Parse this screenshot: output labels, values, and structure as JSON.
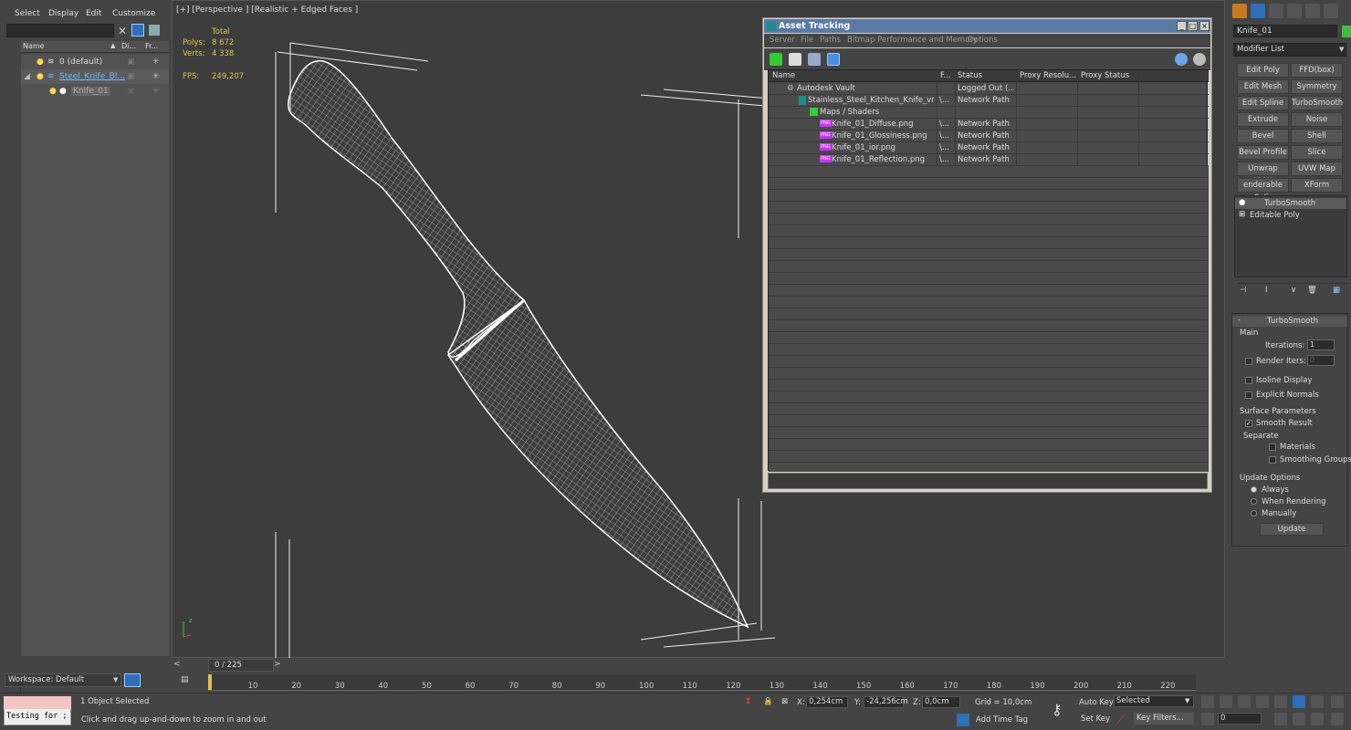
{
  "explorer": {
    "menu": [
      "Select",
      "Display",
      "Edit",
      "Customize"
    ],
    "columns": [
      "Name",
      "Di...",
      "Fr..."
    ],
    "rows": [
      {
        "label": "0 (default)"
      },
      {
        "label": "Steel_Knife_Bl..."
      },
      {
        "label": "Knife_01"
      }
    ],
    "workspace_label": "Workspace: Default"
  },
  "viewport": {
    "label": "[+] [Perspective ] [Realistic + Edged Faces ]",
    "stats_total_label": "Total",
    "polys_label": "Polys:",
    "polys_value": "8 672",
    "verts_label": "Verts:",
    "verts_value": "4 338",
    "fps_label": "FPS:",
    "fps_value": "249,207"
  },
  "asset_tracking": {
    "title": "Asset Tracking",
    "menu": [
      "Server",
      "File",
      "Paths",
      "Bitmap Performance and Memory",
      "Options"
    ],
    "columns": [
      "Name",
      "F...",
      "Status",
      "Proxy Resolu...",
      "Proxy Status"
    ],
    "rows": [
      {
        "name": "Autodesk Vault",
        "f": "",
        "status": "Logged Out (...",
        "indent": 1
      },
      {
        "name": "Stainless_Steel_Kitchen_Knife_vra...",
        "f": "\\...",
        "status": "Network Path",
        "indent": 2
      },
      {
        "name": "Maps / Shaders",
        "f": "",
        "status": "",
        "indent": 3
      },
      {
        "name": "Knife_01_Diffuse.png",
        "f": "\\...",
        "status": "Network Path",
        "indent": 4
      },
      {
        "name": "Knife_01_Glossiness.png",
        "f": "\\...",
        "status": "Network Path",
        "indent": 4
      },
      {
        "name": "Knife_01_ior.png",
        "f": "\\...",
        "status": "Network Path",
        "indent": 4
      },
      {
        "name": "Knife_01_Reflection.png",
        "f": "\\...",
        "status": "Network Path",
        "indent": 4
      }
    ],
    "png_badge": "PNG"
  },
  "command_panel": {
    "object_name": "Knife_01",
    "color": "#3fbf3f",
    "modifier_list": "Modifier List",
    "buttons": [
      "Edit Poly",
      "FFD(box)",
      "Edit Mesh",
      "Symmetry",
      "Edit Spline",
      "TurboSmooth",
      "Extrude",
      "Noise",
      "Bevel",
      "Shell",
      "Bevel Profile",
      "Slice",
      "Unwrap UVW",
      "UVW Map",
      "enderable Splir",
      "XForm"
    ],
    "stack": [
      "TurboSmooth",
      "Editable Poly"
    ],
    "rollout": {
      "title": "TurboSmooth",
      "main": "Main",
      "iterations_label": "Iterations:",
      "iterations_value": "1",
      "render_iters_label": "Render Iters:",
      "render_iters_value": "0",
      "isoline": "Isoline Display",
      "explicit_normals": "Explicit Normals",
      "surface_params": "Surface Parameters",
      "smooth_result": "Smooth Result",
      "separate": "Separate",
      "materials": "Materials",
      "smoothing_groups": "Smoothing Groups",
      "update_options": "Update Options",
      "always": "Always",
      "when_rendering": "When Rendering",
      "manually": "Manually",
      "update_button": "Update"
    }
  },
  "timeline": {
    "frame_label": "0 / 225",
    "ticks": [
      "10",
      "20",
      "30",
      "40",
      "50",
      "60",
      "70",
      "80",
      "90",
      "100",
      "110",
      "120",
      "130",
      "140",
      "150",
      "160",
      "170",
      "180",
      "190",
      "200",
      "210",
      "220"
    ]
  },
  "status": {
    "maxscript": "Testing for ;",
    "selected_text": "1 Object Selected",
    "prompt": "Click and drag up-and-down to zoom in and out",
    "x_label": "X:",
    "x_value": "0,254cm",
    "y_label": "Y:",
    "y_value": "-24,256cm",
    "z_label": "Z:",
    "z_value": "0,0cm",
    "grid": "Grid = 10,0cm",
    "add_time_tag": "Add Time Tag",
    "auto_key": "Auto Key",
    "set_key": "Set Key",
    "selected_dropdown": "Selected",
    "key_filters": "Key Filters...",
    "frame_field": "0"
  }
}
